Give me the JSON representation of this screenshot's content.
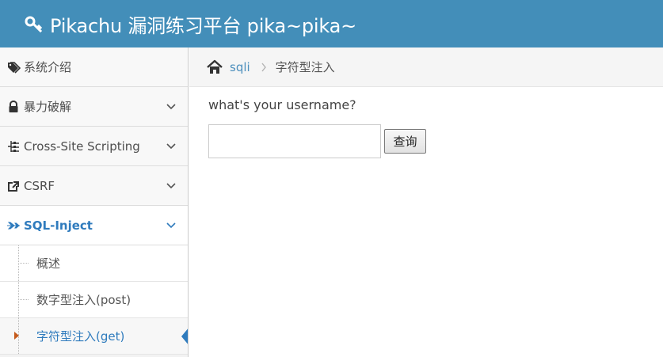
{
  "header": {
    "title": "Pikachu 漏洞练习平台 pika~pika~",
    "icon": "key-icon",
    "background": "#438eb9"
  },
  "sidebar": {
    "items": [
      {
        "label": "系统介绍",
        "icon": "tags-icon",
        "expanded": false
      },
      {
        "label": "暴力破解",
        "icon": "lock-icon",
        "expanded": false
      },
      {
        "label": "Cross-Site Scripting",
        "icon": "sitemap-icon",
        "expanded": false
      },
      {
        "label": "CSRF",
        "icon": "share-icon",
        "expanded": false
      },
      {
        "label": "SQL-Inject",
        "icon": "plane-icon",
        "expanded": true
      }
    ],
    "submenu": [
      {
        "label": "概述",
        "active": false
      },
      {
        "label": "数字型注入(post)",
        "active": false
      },
      {
        "label": "字符型注入(get)",
        "active": true
      }
    ],
    "active_color": "#2f7bbd"
  },
  "breadcrumb": {
    "home_icon": "home-icon",
    "link": "sqli",
    "current": "字符型注入"
  },
  "main": {
    "prompt": "what's your username?",
    "username_value": "",
    "username_placeholder": "",
    "button_label": "查询"
  }
}
